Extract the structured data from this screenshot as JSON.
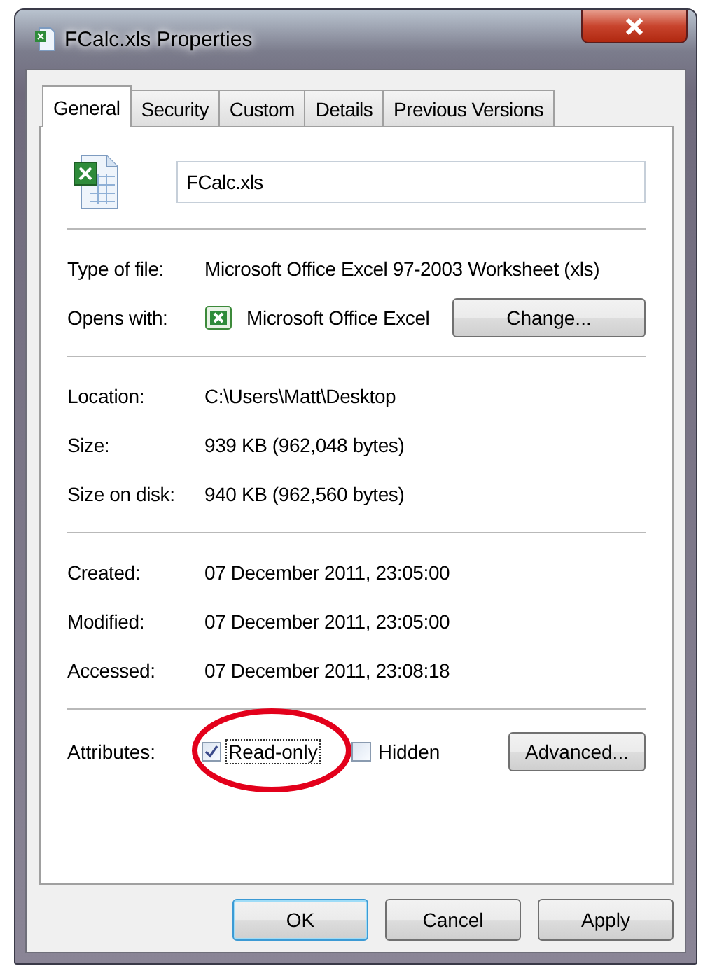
{
  "window": {
    "title": "FCalc.xls Properties"
  },
  "tabs": [
    {
      "label": "General",
      "selected": true
    },
    {
      "label": "Security",
      "selected": false
    },
    {
      "label": "Custom",
      "selected": false
    },
    {
      "label": "Details",
      "selected": false
    },
    {
      "label": "Previous Versions",
      "selected": false
    }
  ],
  "file_name": {
    "value": "FCalc.xls"
  },
  "groups": [
    [
      {
        "label": "Type of file:",
        "value": "Microsoft Office Excel 97-2003 Worksheet (xls)"
      },
      {
        "label": "Opens with:",
        "value": "Microsoft Office Excel",
        "kind": "app",
        "button": "Change..."
      }
    ],
    [
      {
        "label": "Location:",
        "value": "C:\\Users\\Matt\\Desktop"
      },
      {
        "label": "Size:",
        "value": "939 KB (962,048 bytes)"
      },
      {
        "label": "Size on disk:",
        "value": "940 KB (962,560 bytes)"
      }
    ],
    [
      {
        "label": "Created:",
        "value": "07 December 2011, 23:05:00"
      },
      {
        "label": "Modified:",
        "value": "07 December 2011, 23:05:00"
      },
      {
        "label": "Accessed:",
        "value": "07 December 2011, 23:08:18"
      }
    ]
  ],
  "attributes": {
    "label": "Attributes:",
    "checkboxes": [
      {
        "label": "Read-only",
        "checked": true,
        "focused": true
      },
      {
        "label": "Hidden",
        "checked": false,
        "focused": false
      }
    ],
    "button": "Advanced..."
  },
  "annotation": {
    "kind": "ellipse",
    "color": "#e3001b"
  },
  "buttons": [
    {
      "label": "OK",
      "default": true
    },
    {
      "label": "Cancel",
      "default": false
    },
    {
      "label": "Apply",
      "default": false
    }
  ]
}
